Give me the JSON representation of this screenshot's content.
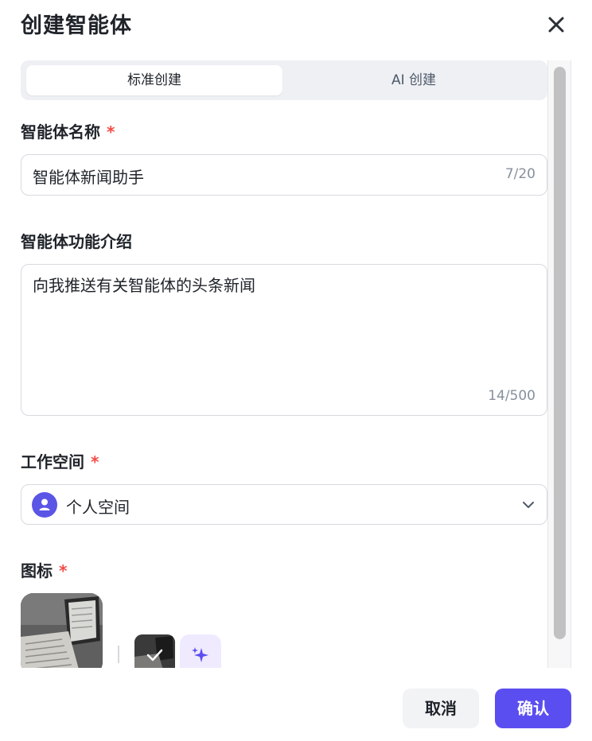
{
  "dialog": {
    "title": "创建智能体"
  },
  "tabs": [
    {
      "label": "标准创建",
      "active": true
    },
    {
      "label": "AI 创建",
      "active": false
    }
  ],
  "name_field": {
    "label": "智能体名称",
    "required_mark": "*",
    "value": "智能体新闻助手",
    "counter": "7/20"
  },
  "description_field": {
    "label": "智能体功能介绍",
    "value": "向我推送有关智能体的头条新闻",
    "counter": "14/500"
  },
  "workspace_field": {
    "label": "工作空间",
    "required_mark": "*",
    "selected": "个人空间"
  },
  "icon_field": {
    "label": "图标",
    "required_mark": "*"
  },
  "footer": {
    "cancel_label": "取消",
    "confirm_label": "确认"
  },
  "colors": {
    "accent": "#5b4ef0",
    "required": "#f54a45",
    "segment_bg": "#eef0f4",
    "ai_icon_bg": "#efeafe"
  }
}
